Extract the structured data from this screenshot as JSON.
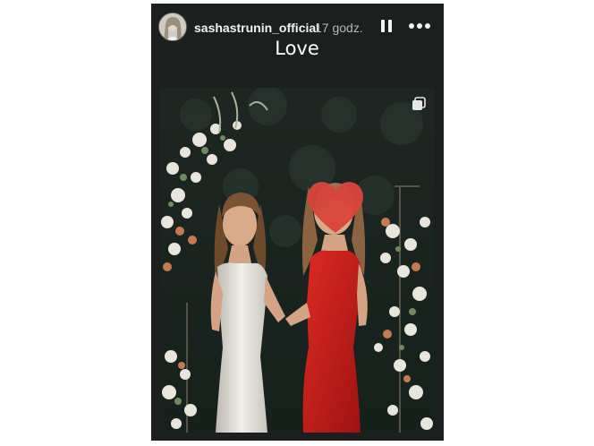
{
  "story": {
    "username": "sashastrunin_official",
    "time": "17 godz.",
    "caption": "Love"
  },
  "icons": {
    "avatar": "profile-avatar",
    "pause": "pause-icon",
    "more": "more-icon",
    "stack": "stack-icon",
    "heart": "heart-icon"
  },
  "colors": {
    "story_bg": "#1b1f1d",
    "heart": "#d7453b",
    "red_dress": "#c81f1c",
    "white_dress": "#eceae6"
  }
}
